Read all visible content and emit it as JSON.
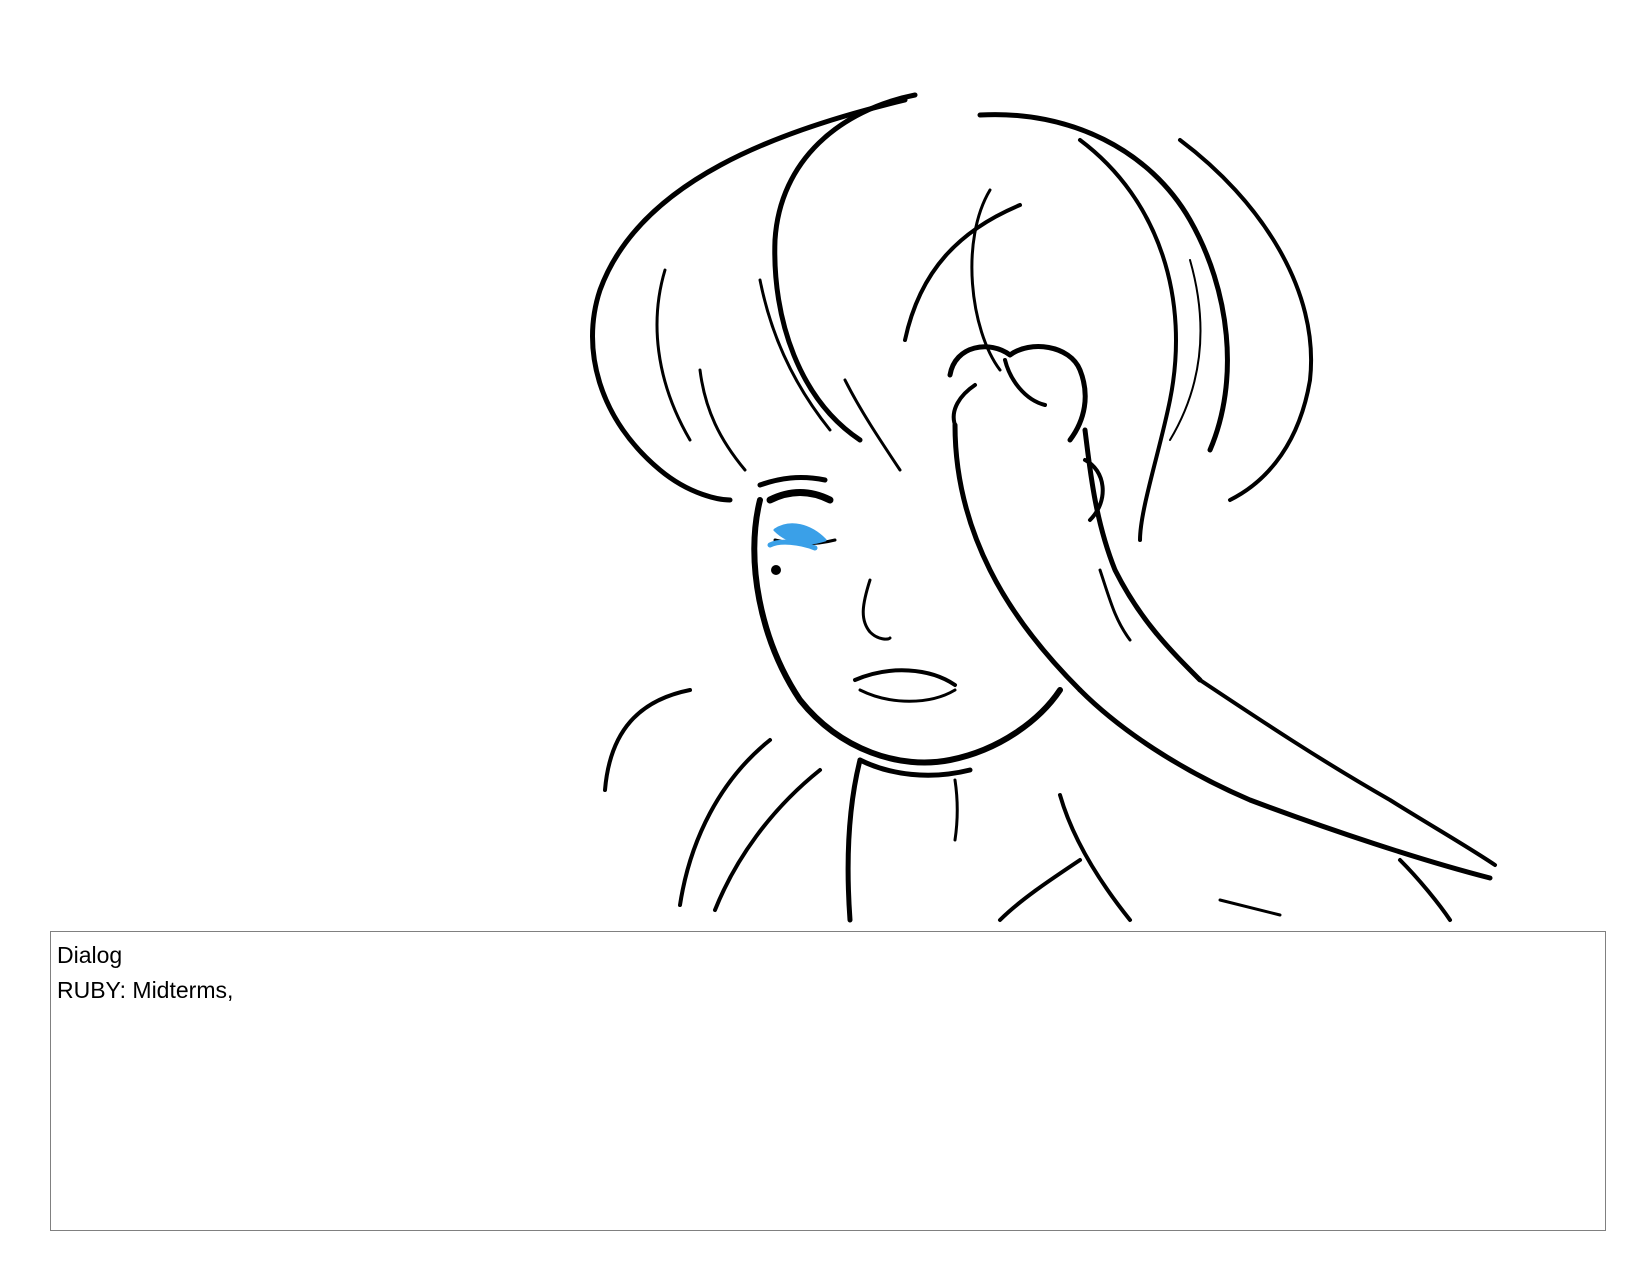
{
  "storyboard": {
    "panel_art": {
      "description_icon": "character-crying-sketch",
      "line_color": "#000000",
      "tear_color": "#3aa0e8"
    },
    "dialog": {
      "heading": "Dialog",
      "line": "RUBY: Midterms,"
    }
  }
}
